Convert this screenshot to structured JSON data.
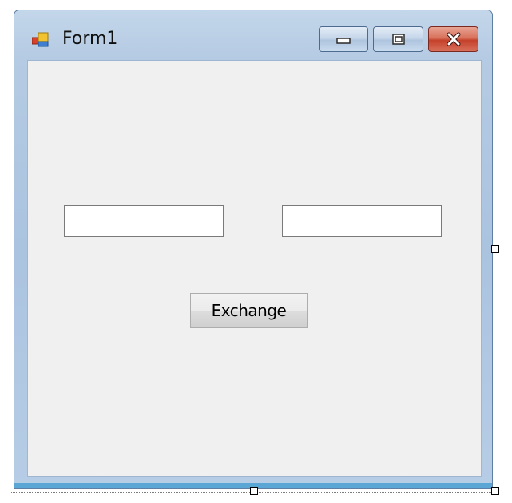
{
  "window": {
    "title": "Form1",
    "icon": "winforms-app-icon",
    "caption_buttons": {
      "minimize": "minimize-icon",
      "maximize": "maximize-icon",
      "close": "close-icon"
    }
  },
  "form": {
    "textbox_left": {
      "value": "",
      "placeholder": ""
    },
    "textbox_right": {
      "value": "",
      "placeholder": ""
    },
    "exchange_button_label": "Exchange"
  },
  "designer": {
    "selection_handles": [
      "right-resize-handle",
      "bottom-resize-handle",
      "corner-resize-handle"
    ]
  },
  "colors": {
    "client_background": "#f0f0f0",
    "close_button": "#c4402a",
    "frame": "#aac3df"
  }
}
